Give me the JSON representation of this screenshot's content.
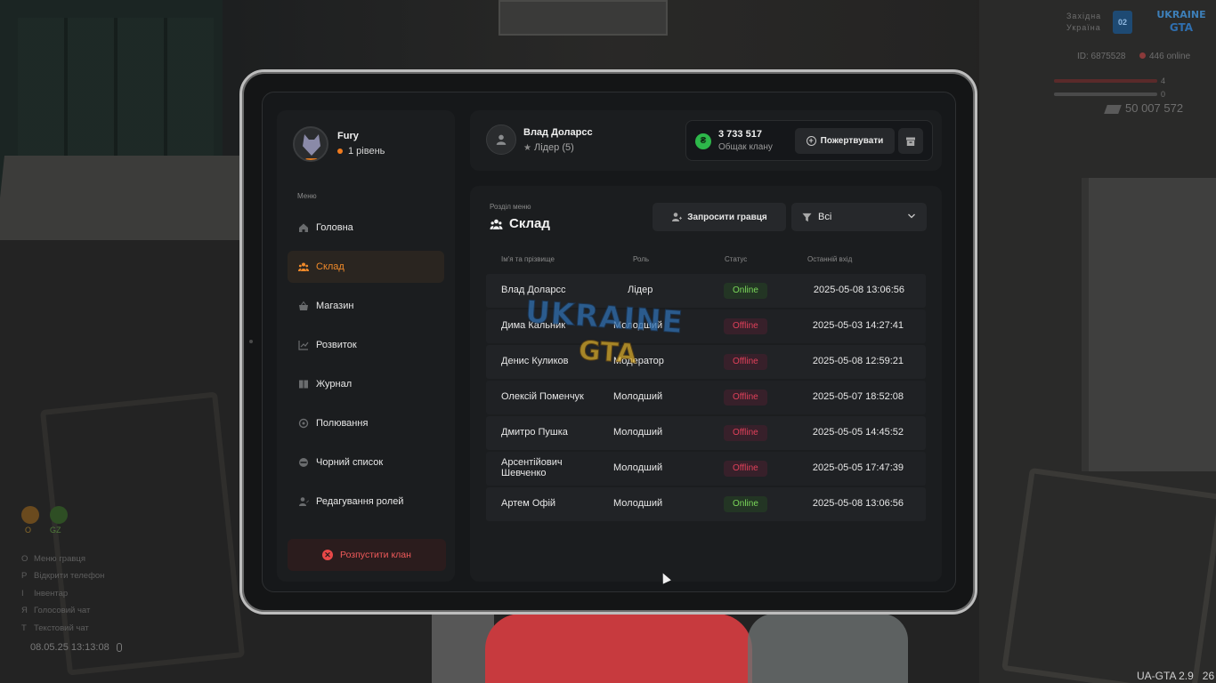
{
  "hud": {
    "server_name": "Західна Україна",
    "server_badge": "02",
    "logo_text_1": "UKRAINE",
    "logo_text_2": "GTA",
    "id_text": "ID: 6875528",
    "online_text": "446 online",
    "bar1_value": "4",
    "bar2_value": "0",
    "money": "50 007 572",
    "indicator_o": "O",
    "indicator_gz": "GZ",
    "keys": [
      {
        "key": "O",
        "label": "Меню гравця"
      },
      {
        "key": "P",
        "label": "Відкрити телефон"
      },
      {
        "key": "I",
        "label": "Інвентар"
      },
      {
        "key": "Я",
        "label": "Голосовий чат"
      },
      {
        "key": "T",
        "label": "Текстовий чат"
      }
    ],
    "datetime": "08.05.25 13:13:08",
    "version": "UA-GTA 2.9   26"
  },
  "profile": {
    "name": "Fury",
    "level": "1 рівень"
  },
  "sidebar": {
    "menu_title": "Меню",
    "items": [
      {
        "label": "Головна",
        "icon": "home-icon",
        "active": false
      },
      {
        "label": "Склад",
        "icon": "members-icon",
        "active": true
      },
      {
        "label": "Магазин",
        "icon": "shop-basket-icon",
        "active": false
      },
      {
        "label": "Розвиток",
        "icon": "chart-icon",
        "active": false
      },
      {
        "label": "Журнал",
        "icon": "book-icon",
        "active": false
      },
      {
        "label": "Полювання",
        "icon": "target-icon",
        "active": false
      },
      {
        "label": "Чорний список",
        "icon": "blocked-icon",
        "active": false
      },
      {
        "label": "Редагування ролей",
        "icon": "user-edit-icon",
        "active": false
      }
    ],
    "disband_label": "Розпустити клан"
  },
  "header": {
    "leader_name": "Влад Доларсс",
    "leader_role": "Лідер (5)",
    "money_value": "3 733 517",
    "money_label": "Общак клану",
    "donate_label": "Пожертвувати"
  },
  "members": {
    "section_sub": "Розділ меню",
    "section_title": "Склад",
    "invite_label": "Запросити гравця",
    "filter_value": "Всі",
    "columns": {
      "name": "Ім'я та прізвище",
      "role": "Роль",
      "status": "Статус",
      "last": "Останній вхід"
    },
    "rows": [
      {
        "name": "Влад Доларсс",
        "role": "Лідер",
        "status": "Online",
        "last": "2025-05-08 13:06:56"
      },
      {
        "name": "Дима Кальник",
        "role": "Молодший",
        "status": "Offline",
        "last": "2025-05-03 14:27:41"
      },
      {
        "name": "Денис Куликов",
        "role": "Модератор",
        "status": "Offline",
        "last": "2025-05-08 12:59:21"
      },
      {
        "name": "Олексій Поменчук",
        "role": "Молодший",
        "status": "Offline",
        "last": "2025-05-07 18:52:08"
      },
      {
        "name": "Дмитро Пушка",
        "role": "Молодший",
        "status": "Offline",
        "last": "2025-05-05 14:45:52"
      },
      {
        "name": "Арсентійович Шевченко",
        "role": "Молодший",
        "status": "Offline",
        "last": "2025-05-05 17:47:39"
      },
      {
        "name": "Артем Офій",
        "role": "Молодший",
        "status": "Online",
        "last": "2025-05-08 13:06:56"
      }
    ]
  },
  "watermark": {
    "line1": "UKRAINE",
    "line2": "GTA"
  },
  "colors": {
    "accent": "#f08a2a",
    "online": "#7ad85a",
    "offline": "#e0405a",
    "danger": "#e84848",
    "money": "#2db84a"
  }
}
